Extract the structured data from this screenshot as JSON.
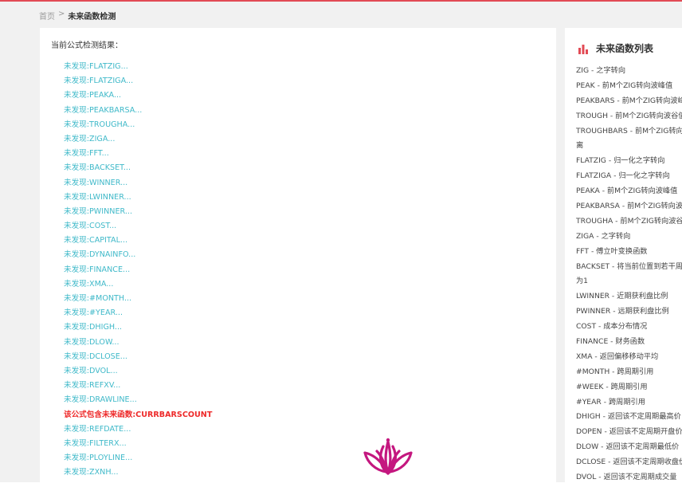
{
  "breadcrumb": {
    "home": "首页",
    "separator": ">",
    "current": "未来函数检测"
  },
  "result_panel": {
    "title": "当前公式检测结果：",
    "items": [
      "未发现:FLATZIG...",
      "未发现:FLATZIGA...",
      "未发现:PEAKA...",
      "未发现:PEAKBARSA...",
      "未发现:TROUGHA...",
      "未发现:ZIGA...",
      "未发现:FFT...",
      "未发现:BACKSET...",
      "未发现:WINNER...",
      "未发现:LWINNER...",
      "未发现:PWINNER...",
      "未发现:COST...",
      "未发现:CAPITAL...",
      "未发现:DYNAINFO...",
      "未发现:FINANCE...",
      "未发现:XMA...",
      "未发现:#MONTH...",
      "未发现:#YEAR...",
      "未发现:DHIGH...",
      "未发现:DLOW...",
      "未发现:DCLOSE...",
      "未发现:DVOL...",
      "未发现:REFXV...",
      "未发现:DRAWLINE...",
      "该公式包含未来函数:CURRBARSCOUNT",
      "未发现:REFDATE...",
      "未发现:FILTERX...",
      "未发现:PLOYLINE...",
      "未发现:ZXNH..."
    ],
    "warning_index": 24
  },
  "function_panel": {
    "title": "未来函数列表",
    "icon": "bar-chart-icon",
    "items": [
      "ZIG - 之字转向",
      "PEAK - 前M个ZIG转向波峰值",
      "PEAKBARS - 前M个ZIG转向波峰到当前距离",
      "TROUGH - 前M个ZIG转向波谷值",
      "TROUGHBARS - 前M个ZIG转向波谷到当前距",
      "离",
      "FLATZIG - 归一化之字转向",
      "FLATZIGA - 归一化之字转向",
      "PEAKA - 前M个ZIG转向波峰值",
      "PEAKBARSA - 前M个ZIG转向波峰",
      "TROUGHA - 前M个ZIG转向波谷值",
      "ZIGA - 之字转向",
      "FFT - 傅立叶变换函数",
      "BACKSET - 将当前位置到若干周期前的数据设",
      "为1",
      "LWINNER - 近期获利盘比例",
      "PWINNER - 远期获利盘比例",
      "COST - 成本分布情况",
      "FINANCE - 财务函数",
      "XMA - 返回偏移移动平均",
      "#MONTH - 跨周期引用",
      "#WEEK - 跨周期引用",
      "#YEAR - 跨周期引用",
      "DHIGH - 返回该不定周期最高价",
      "DOPEN - 返回该不定周期开盘价",
      "DLOW - 返回该不定周期最低价",
      "DCLOSE - 返回该不定周期收盘价",
      "DVOL - 返回该不定周期成交量"
    ]
  },
  "colors": {
    "accent_red": "#e24b55",
    "link_teal": "#3fb9c9",
    "warning_red": "#ee2a2a",
    "lotus_magenta": "#c4177f"
  }
}
